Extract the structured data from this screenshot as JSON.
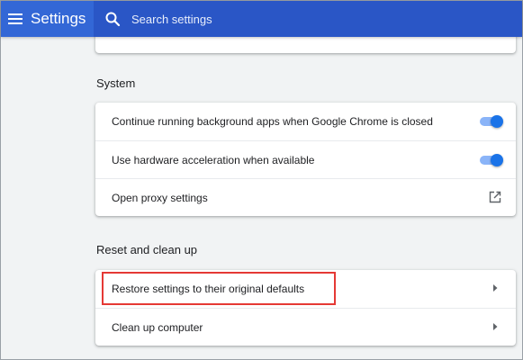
{
  "colors": {
    "header_bg": "#3367d6",
    "search_bg": "#2a56c6",
    "toggle_track": "#8ab4f8",
    "toggle_knob": "#1a73e8",
    "highlight": "#e53935"
  },
  "header": {
    "menu_icon": "hamburger-menu-icon",
    "title": "Settings",
    "search_icon": "search-icon",
    "search_placeholder": "Search settings",
    "search_value": ""
  },
  "sections": [
    {
      "title": "System",
      "rows": [
        {
          "label": "Continue running background apps when Google Chrome is closed",
          "control": "toggle",
          "checked": true
        },
        {
          "label": "Use hardware acceleration when available",
          "control": "toggle",
          "checked": true
        },
        {
          "label": "Open proxy settings",
          "control": "external-link",
          "icon": "open-in-new-icon"
        }
      ]
    },
    {
      "title": "Reset and clean up",
      "rows": [
        {
          "label": "Restore settings to their original defaults",
          "control": "arrow",
          "icon": "arrow-right-icon",
          "highlighted": true
        },
        {
          "label": "Clean up computer",
          "control": "arrow",
          "icon": "arrow-right-icon"
        }
      ]
    }
  ]
}
